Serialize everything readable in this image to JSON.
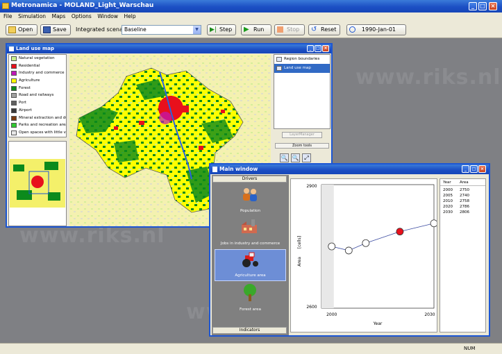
{
  "app": {
    "title": "Metronamica - MOLAND_Light_Warschau"
  },
  "menu": [
    "File",
    "Simulation",
    "Maps",
    "Options",
    "Window",
    "Help"
  ],
  "toolbar": {
    "open": "Open",
    "save": "Save",
    "scenario_label": "Integrated scenario:",
    "scenario_value": "Baseline",
    "step": "Step",
    "run": "Run",
    "stop": "Stop",
    "reset": "Reset",
    "date": "1990-Jan-01"
  },
  "watermark": "www.riks.nl",
  "landuse": {
    "title": "Land use map",
    "legend": [
      {
        "label": "Natural vegetation",
        "color": "#c8f08c"
      },
      {
        "label": "Residential",
        "color": "#e8101c"
      },
      {
        "label": "Industry and commerce",
        "color": "#c018b8"
      },
      {
        "label": "Agriculture",
        "color": "#ffff00"
      },
      {
        "label": "Forest",
        "color": "#0c8a1c"
      },
      {
        "label": "Road and railways",
        "color": "#a0a0a0"
      },
      {
        "label": "Port",
        "color": "#606060"
      },
      {
        "label": "Airport",
        "color": "#383838"
      },
      {
        "label": "Mineral extraction and dump sites",
        "color": "#7a3a10"
      },
      {
        "label": "Parks and recreation areas",
        "color": "#30c830"
      },
      {
        "label": "Open spaces with little vegetation",
        "color": "#e8e8e8"
      }
    ],
    "layers": [
      "Region boundaries",
      "Land use map"
    ],
    "layer_manager": "LayerManager",
    "zoom_tools": "Zoom tools"
  },
  "main": {
    "title": "Main window",
    "drivers_header": "Drivers",
    "indicators": "Indicators",
    "drivers": [
      {
        "label": "Population",
        "icon": "people-icon"
      },
      {
        "label": "Jobs in industry and commerce",
        "icon": "factory-icon"
      },
      {
        "label": "Agriculture area",
        "icon": "tractor-icon"
      },
      {
        "label": "Forest area",
        "icon": "tree-icon"
      }
    ],
    "table": {
      "headers": [
        "Year",
        "Area"
      ],
      "rows": [
        [
          "2000",
          "2750"
        ],
        [
          "2005",
          "2740"
        ],
        [
          "2010",
          "2758"
        ],
        [
          "2020",
          "2786"
        ],
        [
          "2030",
          "2806"
        ]
      ]
    }
  },
  "chart_data": {
    "type": "line",
    "x": [
      2000,
      2005,
      2010,
      2020,
      2030
    ],
    "values": [
      2750,
      2740,
      2758,
      2786,
      2806
    ],
    "highlight_index": 3,
    "ylabel": "Area",
    "yunit": "[cells]",
    "xlabel": "Year",
    "ylim": [
      2600,
      2900
    ],
    "xlim": [
      1997,
      2030
    ],
    "yticks": [
      "2900",
      "2600"
    ],
    "xticks": [
      "2000",
      "2030"
    ]
  },
  "status": {
    "num": "NUM"
  },
  "colors": {
    "accent": "#1c56d4",
    "highlight": "#e8101c",
    "agri": "#ffff00",
    "forest": "#0c8a1c"
  }
}
